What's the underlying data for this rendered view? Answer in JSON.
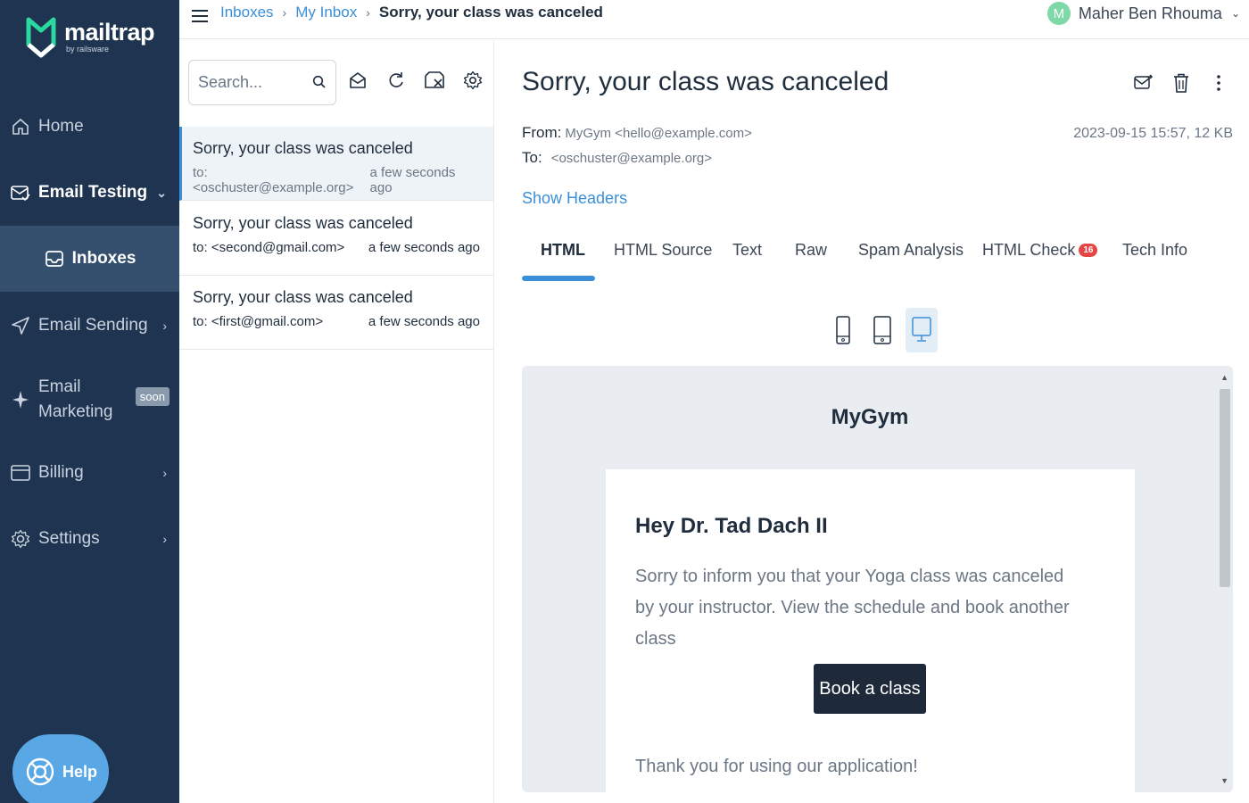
{
  "brand": {
    "name": "mailtrap",
    "by": "by railsware"
  },
  "sidebar": {
    "items": [
      {
        "label": "Home",
        "icon": "home-icon"
      },
      {
        "label": "Email Testing",
        "icon": "email-testing-icon"
      },
      {
        "label": "Inboxes",
        "icon": "inbox-icon"
      },
      {
        "label": "Email Sending",
        "icon": "send-icon"
      },
      {
        "label": "Email",
        "label2": "Marketing",
        "badge": "soon",
        "icon": "sparkle-icon"
      },
      {
        "label": "Billing",
        "icon": "billing-icon"
      },
      {
        "label": "Settings",
        "icon": "gear-icon"
      }
    ],
    "help_label": "Help"
  },
  "topbar": {
    "breadcrumbs": [
      "Inboxes",
      "My Inbox",
      "Sorry, your class was canceled"
    ],
    "user": {
      "initial": "M",
      "name": "Maher Ben Rhouma"
    }
  },
  "list": {
    "search_placeholder": "Search...",
    "messages": [
      {
        "subject": "Sorry, your class was canceled",
        "to": "to: <oschuster@example.org>",
        "time": "a few seconds ago"
      },
      {
        "subject": "Sorry, your class was canceled",
        "to": "to: <second@gmail.com>",
        "time": "a few seconds ago"
      },
      {
        "subject": "Sorry, your class was canceled",
        "to": "to: <first@gmail.com>",
        "time": "a few seconds ago"
      }
    ]
  },
  "detail": {
    "title": "Sorry, your class was canceled",
    "from_label": "From:",
    "from_value": "MyGym <hello@example.com>",
    "to_label": "To:",
    "to_value": "<oschuster@example.org>",
    "date_size": "2023-09-15 15:57, 12 KB",
    "show_headers": "Show Headers",
    "tabs": [
      {
        "label": "HTML"
      },
      {
        "label": "HTML Source"
      },
      {
        "label": "Text"
      },
      {
        "label": "Raw"
      },
      {
        "label": "Spam Analysis"
      },
      {
        "label": "HTML Check",
        "badge": "16"
      },
      {
        "label": "Tech Info"
      }
    ]
  },
  "email": {
    "brand": "MyGym",
    "greeting": "Hey Dr. Tad Dach II",
    "body": "Sorry to inform you that your Yoga class was canceled by your instructor. View the schedule and book another class",
    "button": "Book a class",
    "thanks": "Thank you for using our application!"
  },
  "colors": {
    "sidebar_bg": "#1e3450",
    "accent": "#3a8fd8",
    "help_bg": "#5aa7e6",
    "badge_red": "#e64545"
  }
}
